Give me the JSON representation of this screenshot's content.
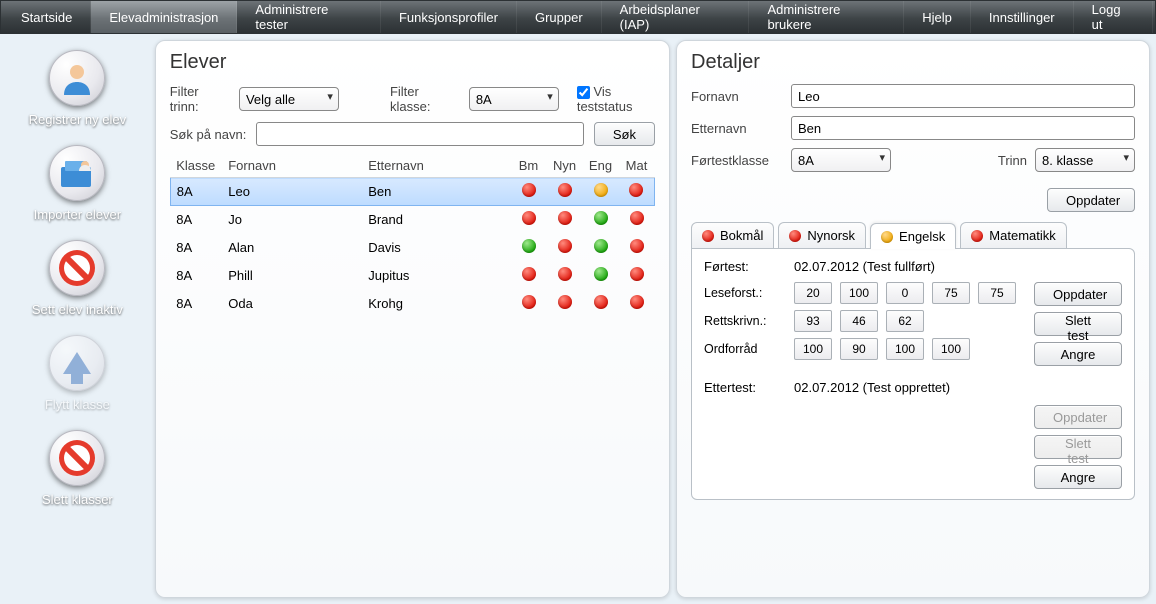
{
  "nav": {
    "items": [
      "Startside",
      "Elevadministrasjon",
      "Administrere tester",
      "Funksjonsprofiler",
      "Grupper",
      "Arbeidsplaner (IAP)",
      "Administrere brukere",
      "Hjelp",
      "Innstillinger",
      "Logg ut"
    ],
    "active_index": 1
  },
  "sidebar": {
    "items": [
      {
        "label": "Registrer ny elev"
      },
      {
        "label": "Importer elever"
      },
      {
        "label": "Sett elev inaktiv"
      },
      {
        "label": "Flytt klasse"
      },
      {
        "label": "Slett klasser"
      }
    ]
  },
  "students_panel": {
    "title": "Elever",
    "filter_trinn_label": "Filter trinn:",
    "filter_trinn_value": "Velg alle",
    "filter_klasse_label": "Filter klasse:",
    "filter_klasse_value": "8A",
    "vis_teststatus_label": "Vis teststatus",
    "vis_teststatus_checked": true,
    "search_label": "Søk på navn:",
    "search_value": "",
    "search_button": "Søk",
    "columns": [
      "Klasse",
      "Fornavn",
      "Etternavn",
      "Bm",
      "Nyn",
      "Eng",
      "Mat"
    ],
    "selected_index": 0,
    "rows": [
      {
        "klasse": "8A",
        "fornavn": "Leo",
        "etternavn": "Ben",
        "dots": [
          "red",
          "red",
          "orange",
          "red"
        ]
      },
      {
        "klasse": "8A",
        "fornavn": "Jo",
        "etternavn": "Brand",
        "dots": [
          "red",
          "red",
          "green",
          "red"
        ]
      },
      {
        "klasse": "8A",
        "fornavn": "Alan",
        "etternavn": "Davis",
        "dots": [
          "green",
          "red",
          "green",
          "red"
        ]
      },
      {
        "klasse": "8A",
        "fornavn": "Phill",
        "etternavn": "Jupitus",
        "dots": [
          "red",
          "red",
          "green",
          "red"
        ]
      },
      {
        "klasse": "8A",
        "fornavn": "Oda",
        "etternavn": "Krohg",
        "dots": [
          "red",
          "red",
          "red",
          "red"
        ]
      }
    ]
  },
  "details_panel": {
    "title": "Detaljer",
    "fornavn_label": "Fornavn",
    "fornavn_value": "Leo",
    "etternavn_label": "Etternavn",
    "etternavn_value": "Ben",
    "fortestklasse_label": "Førtestklasse",
    "fortestklasse_value": "8A",
    "trinn_label": "Trinn",
    "trinn_value": "8. klasse",
    "oppdater_btn": "Oppdater",
    "tabs": [
      {
        "label": "Bokmål",
        "color": "red"
      },
      {
        "label": "Nynorsk",
        "color": "red"
      },
      {
        "label": "Engelsk",
        "color": "orange"
      },
      {
        "label": "Matematikk",
        "color": "red"
      }
    ],
    "active_tab": 2,
    "test": {
      "fortest_label": "Førtest:",
      "fortest_value": "02.07.2012 (Test fullført)",
      "leseforst_label": "Leseforst.:",
      "leseforst_values": [
        "20",
        "100",
        "0",
        "75",
        "75"
      ],
      "rettskriv_label": "Rettskrivn.:",
      "rettskriv_values": [
        "93",
        "46",
        "62"
      ],
      "ordforrad_label": "Ordforråd",
      "ordforrad_values": [
        "100",
        "90",
        "100",
        "100"
      ],
      "ettertest_label": "Ettertest:",
      "ettertest_value": "02.07.2012 (Test opprettet)",
      "btn_oppdater": "Oppdater",
      "btn_slett": "Slett test",
      "btn_angre": "Angre"
    }
  }
}
